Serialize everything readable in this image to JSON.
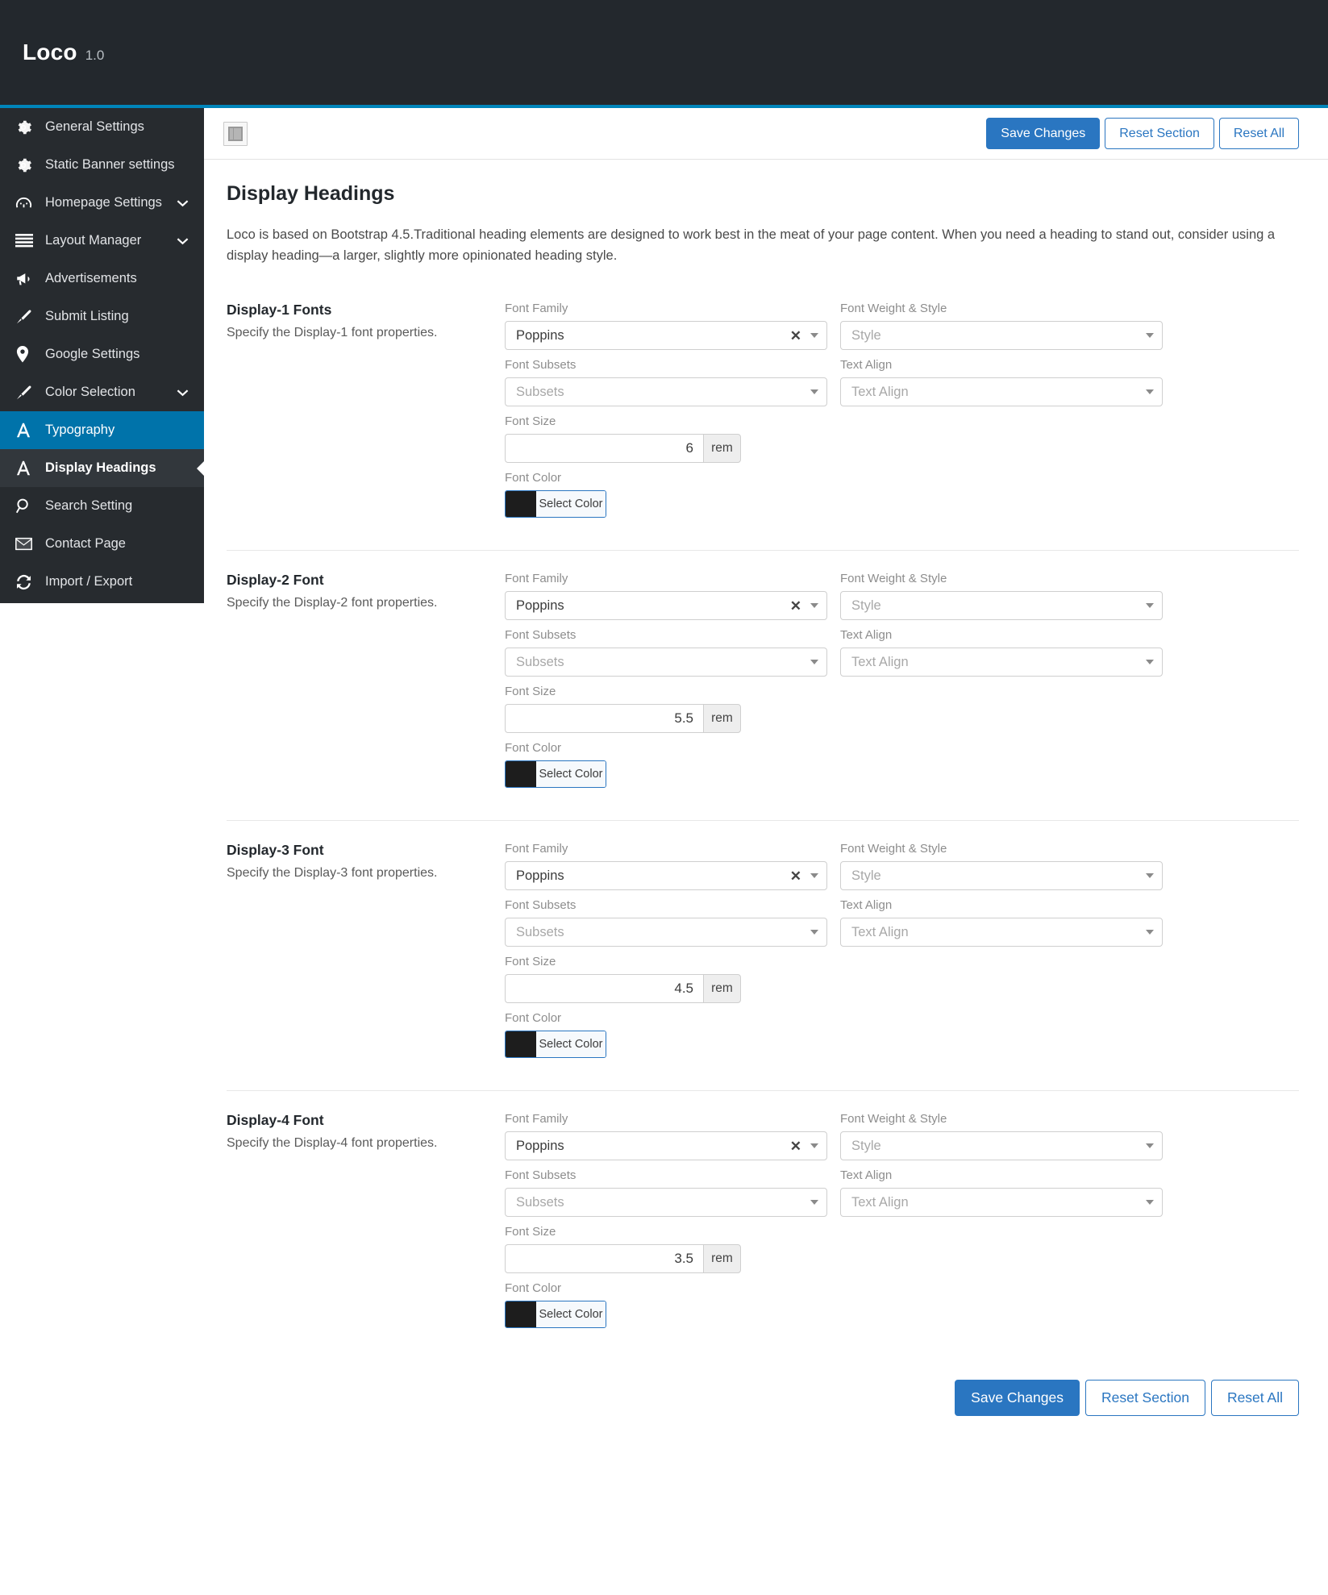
{
  "header": {
    "brand_name": "Loco",
    "version": "1.0"
  },
  "sidebar": {
    "items": [
      {
        "label": "General Settings",
        "icon": "gear-icon",
        "expandable": false,
        "state": "normal"
      },
      {
        "label": "Static Banner settings",
        "icon": "gear-icon",
        "expandable": false,
        "state": "normal"
      },
      {
        "label": "Homepage Settings",
        "icon": "gauge-icon",
        "expandable": true,
        "state": "normal"
      },
      {
        "label": "Layout Manager",
        "icon": "lines-icon",
        "expandable": true,
        "state": "normal"
      },
      {
        "label": "Advertisements",
        "icon": "megaphone-icon",
        "expandable": false,
        "state": "normal"
      },
      {
        "label": "Submit Listing",
        "icon": "brush-icon",
        "expandable": false,
        "state": "normal"
      },
      {
        "label": "Google Settings",
        "icon": "map-pin-icon",
        "expandable": false,
        "state": "normal"
      },
      {
        "label": "Color Selection",
        "icon": "brush-icon",
        "expandable": true,
        "state": "normal"
      },
      {
        "label": "Typography",
        "icon": "letter-a-icon",
        "expandable": false,
        "state": "active"
      },
      {
        "label": "Display Headings",
        "icon": "letter-a-icon",
        "expandable": false,
        "state": "sub-active"
      },
      {
        "label": "Search Setting",
        "icon": "magnifier-icon",
        "expandable": false,
        "state": "normal"
      },
      {
        "label": "Contact Page",
        "icon": "envelope-icon",
        "expandable": false,
        "state": "normal"
      },
      {
        "label": "Import / Export",
        "icon": "refresh-icon",
        "expandable": false,
        "state": "normal"
      }
    ]
  },
  "toolbar": {
    "panel_toggle_icon": "layout-panel-icon",
    "save_label": "Save Changes",
    "reset_section_label": "Reset Section",
    "reset_all_label": "Reset All"
  },
  "main": {
    "title": "Display Headings",
    "description": "Loco is based on Bootstrap 4.5.Traditional heading elements are designed to work best in the meat of your page content. When you need a heading to stand out, consider using a display heading—a larger, slightly more opinionated heading style."
  },
  "labels": {
    "font_family": "Font Family",
    "font_subsets": "Font Subsets",
    "font_size": "Font Size",
    "font_color": "Font Color",
    "font_weight_style": "Font Weight & Style",
    "text_align": "Text Align",
    "subsets_placeholder": "Subsets",
    "style_placeholder": "Style",
    "text_align_placeholder": "Text Align",
    "select_color": "Select Color",
    "unit": "rem"
  },
  "colors": {
    "accent_blue": "#0073aa",
    "button_blue": "#2a76c1",
    "topbar_dark": "#23282d",
    "sidebar_dark": "#272b2f",
    "swatch_black": "#1d1d1d"
  },
  "sections": [
    {
      "title": "Display-1 Fonts",
      "subtitle": "Specify the Display-1 font properties.",
      "font_family": "Poppins",
      "font_subsets": "",
      "font_size": "6",
      "font_weight_style": "",
      "text_align": "",
      "font_color": "#1d1d1d"
    },
    {
      "title": "Display-2 Font",
      "subtitle": "Specify the Display-2 font properties.",
      "font_family": "Poppins",
      "font_subsets": "",
      "font_size": "5.5",
      "font_weight_style": "",
      "text_align": "",
      "font_color": "#1d1d1d"
    },
    {
      "title": "Display-3 Font",
      "subtitle": "Specify the Display-3 font properties.",
      "font_family": "Poppins",
      "font_subsets": "",
      "font_size": "4.5",
      "font_weight_style": "",
      "text_align": "",
      "font_color": "#1d1d1d"
    },
    {
      "title": "Display-4 Font",
      "subtitle": "Specify the Display-4 font properties.",
      "font_family": "Poppins",
      "font_subsets": "",
      "font_size": "3.5",
      "font_weight_style": "",
      "text_align": "",
      "font_color": "#1d1d1d"
    }
  ]
}
